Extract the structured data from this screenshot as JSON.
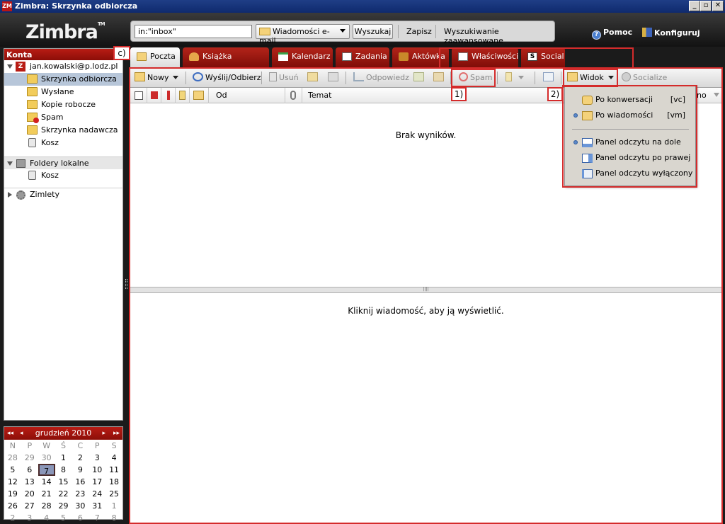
{
  "window": {
    "title": "Zimbra: Skrzynka odbiorcza",
    "app_icon": "ZM",
    "minimize": "_",
    "maximize": "▫",
    "close": "✕"
  },
  "header": {
    "logo": "Zimbra",
    "logo_tm": "TM",
    "search": {
      "value": "in:\"inbox\""
    },
    "search_type": "Wiadomości e-mail",
    "search_button": "Wyszukaj",
    "save_link": "Zapisz",
    "advanced_link": "Wyszukiwanie zaawansowane",
    "help": "Pomoc",
    "configure": "Konfiguruj",
    "help_icon_glyph": "?"
  },
  "sidebar": {
    "header": "Konta",
    "account": "jan.kowalski@p.lodz.pl",
    "account_icon_glyph": "Z",
    "folders": [
      {
        "label": "Skrzynka odbiorcza",
        "icon": "inbox-icon"
      },
      {
        "label": "Wysłane",
        "icon": "sent-icon"
      },
      {
        "label": "Kopie robocze",
        "icon": "drafts-icon"
      },
      {
        "label": "Spam",
        "icon": "spam-icon"
      },
      {
        "label": "Skrzynka nadawcza",
        "icon": "outbox-icon"
      },
      {
        "label": "Kosz",
        "icon": "trash-icon"
      }
    ],
    "local_folders": "Foldery lokalne",
    "local_items": [
      {
        "label": "Kosz",
        "icon": "trash-icon"
      }
    ],
    "zimlets": "Zimlety"
  },
  "calendar": {
    "month": "grudzień 2010",
    "nav_prev_year": "◂◂",
    "nav_prev": "◂",
    "nav_next": "▸",
    "nav_next_year": "▸▸",
    "day_names": [
      "N",
      "P",
      "W",
      "Ś",
      "C",
      "P",
      "S"
    ],
    "weeks": [
      [
        "28",
        "29",
        "30",
        "1",
        "2",
        "3",
        "4"
      ],
      [
        "5",
        "6",
        "7",
        "8",
        "9",
        "10",
        "11"
      ],
      [
        "12",
        "13",
        "14",
        "15",
        "16",
        "17",
        "18"
      ],
      [
        "19",
        "20",
        "21",
        "22",
        "23",
        "24",
        "25"
      ],
      [
        "26",
        "27",
        "28",
        "29",
        "30",
        "31",
        "1"
      ],
      [
        "2",
        "3",
        "4",
        "5",
        "6",
        "7",
        "8"
      ]
    ],
    "today": "7"
  },
  "tabs": [
    {
      "label": "Poczta",
      "icon": "mail-icon"
    },
    {
      "label": "Książka adresowa",
      "icon": "address-book-icon"
    },
    {
      "label": "Kalendarz",
      "icon": "calendar-icon"
    },
    {
      "label": "Zadania",
      "icon": "tasks-icon"
    },
    {
      "label": "Aktówka",
      "icon": "briefcase-icon"
    },
    {
      "label": "Właściwości",
      "icon": "preferences-icon"
    },
    {
      "label": "Social",
      "icon": "social-icon"
    }
  ],
  "social_icon_glyph": "S",
  "toolbar": {
    "new": "Nowy",
    "send_receive": "Wyślij/Odbierz",
    "delete": "Usuń",
    "reply": "Odpowiedz",
    "spam": "Spam",
    "view": "Widok",
    "socialize": "Socialize"
  },
  "columns": {
    "from": "Od",
    "subject": "Temat",
    "date_partial": "no"
  },
  "list": {
    "empty": "Brak wyników."
  },
  "reading_pane": {
    "hint": "Kliknij wiadomość, aby ją wyświetlić."
  },
  "view_menu": [
    {
      "label": "Po konwersacji",
      "shortcut": "[vc]",
      "selected": false
    },
    {
      "label": "Po wiadomości",
      "shortcut": "[vm]",
      "selected": true
    },
    {
      "label": "Panel odczytu na dole",
      "shortcut": "",
      "selected": true
    },
    {
      "label": "Panel odczytu po prawej",
      "shortcut": "",
      "selected": false
    },
    {
      "label": "Panel odczytu wyłączony",
      "shortcut": "",
      "selected": false
    }
  ],
  "annotations": {
    "a1": "1)",
    "a2": "2)",
    "c": "c)"
  },
  "colors": {
    "accent_red": "#b81c14",
    "annotation": "#d42b2b",
    "selection": "#b7c6d9"
  }
}
